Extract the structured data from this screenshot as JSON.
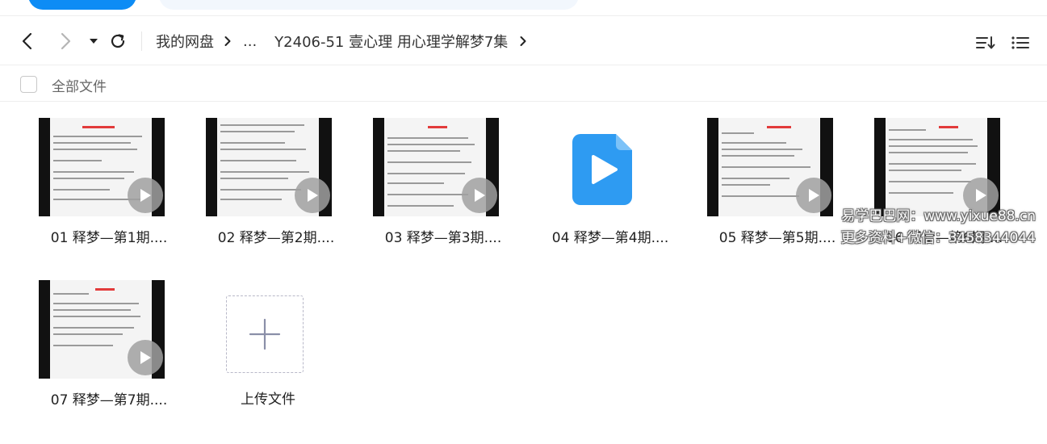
{
  "navigation": {
    "back_icon": "chevron-left-icon",
    "forward_icon": "chevron-right-icon",
    "dropdown_icon": "caret-down-icon",
    "refresh_icon": "refresh-icon"
  },
  "breadcrumb": {
    "root": "我的网盘",
    "ellipsis": "...",
    "current": "Y2406-51 壹心理 用心理学解梦7集"
  },
  "view_controls": {
    "sort_icon": "sort-icon",
    "list_icon": "list-view-icon"
  },
  "toolbar": {
    "select_all_label": "全部文件"
  },
  "files": [
    {
      "name": "01 释梦—第1期....",
      "type": "video",
      "has_thumbnail": true
    },
    {
      "name": "02 释梦—第2期....",
      "type": "video",
      "has_thumbnail": true
    },
    {
      "name": "03 释梦—第3期....",
      "type": "video",
      "has_thumbnail": true
    },
    {
      "name": "04 释梦—第4期....",
      "type": "video",
      "has_thumbnail": false
    },
    {
      "name": "05 释梦—第5期....",
      "type": "video",
      "has_thumbnail": true
    },
    {
      "name": "06 释梦—第6期....",
      "type": "video",
      "has_thumbnail": true
    },
    {
      "name": "07 释梦—第7期....",
      "type": "video",
      "has_thumbnail": true
    }
  ],
  "upload": {
    "label": "上传文件",
    "icon": "plus-icon"
  },
  "watermark": {
    "line1": "易学巴巴网：www.yixue88.cn",
    "line2": "更多资料+微信：3458344044"
  },
  "colors": {
    "accent": "#0d8cf5",
    "video_icon": "#2e9bf2",
    "thumbnail_heading": "#e23b3b"
  }
}
